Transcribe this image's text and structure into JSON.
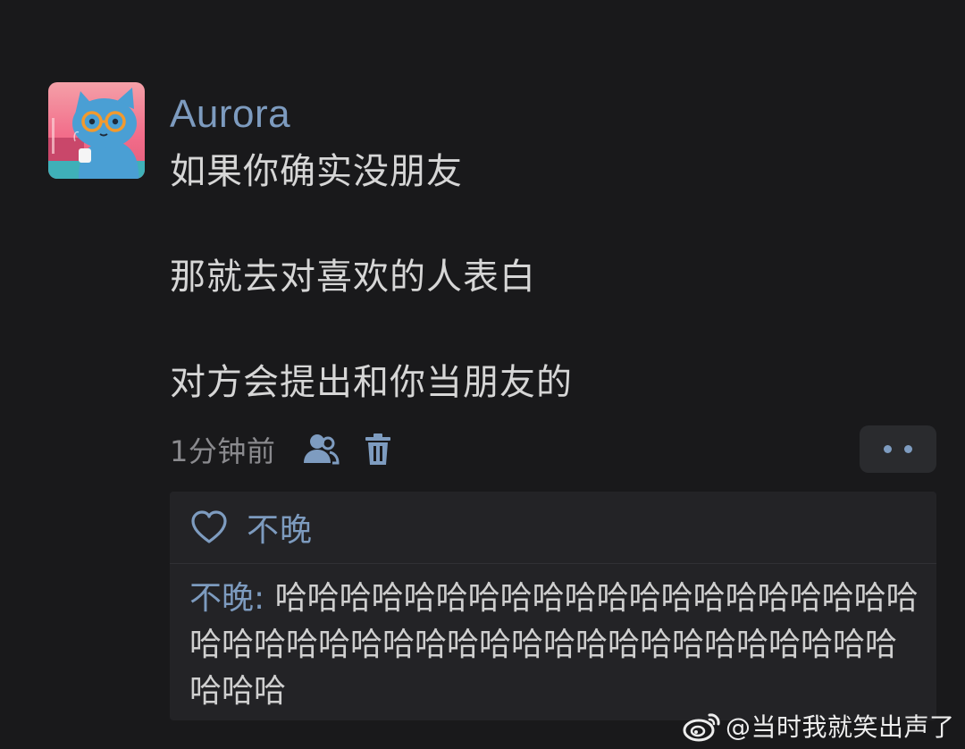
{
  "post": {
    "author": "Aurora",
    "lines": [
      "如果你确实没朋友",
      "那就去对喜欢的人表白",
      "对方会提出和你当朋友的"
    ],
    "timestamp": "1分钟前"
  },
  "likes": {
    "name": "不晚"
  },
  "comment": {
    "author": "不晚",
    "separator": ": ",
    "text": "哈哈哈哈哈哈哈哈哈哈哈哈哈哈哈哈哈哈哈哈哈哈哈哈哈哈哈哈哈哈哈哈哈哈哈哈哈哈哈哈哈哈哈哈哈"
  },
  "watermark": {
    "text": "@当时我就笑出声了"
  },
  "colors": {
    "background": "#19191b",
    "accent": "#7d9bbf",
    "text": "#d6d6d6",
    "muted": "#8a8a8e",
    "reply_background": "#232326"
  },
  "icons": {
    "avatar": "cat-with-sunglasses-avatar",
    "visibility": "friends-visibility-icon",
    "delete": "trash-icon",
    "more": "more-dots-icon",
    "like": "heart-outline-icon",
    "watermark": "weibo-logo-icon"
  }
}
